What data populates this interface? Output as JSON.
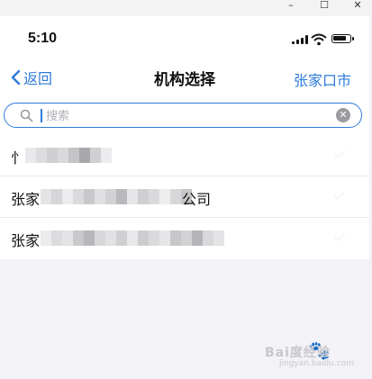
{
  "window": {
    "minimize": "–",
    "maximize": "☐",
    "close": "✕"
  },
  "status_bar": {
    "time": "5:10"
  },
  "nav": {
    "back_label": "返回",
    "title": "机构选择",
    "right_label": "张家口市"
  },
  "search": {
    "placeholder": "搜索",
    "value": ""
  },
  "list": {
    "items": [
      {
        "prefix": "忄",
        "suffix": ""
      },
      {
        "prefix": "张家",
        "suffix": "公司"
      },
      {
        "prefix": "张家",
        "suffix": ""
      }
    ]
  },
  "colors": {
    "accent": "#2f7bd9",
    "background": "#f2f2f7",
    "surface": "#ffffff"
  },
  "watermark": {
    "text": "Bai度经验",
    "subtext": "jingyan.baidu.com"
  }
}
